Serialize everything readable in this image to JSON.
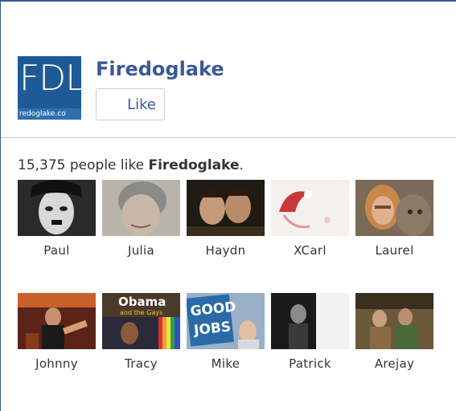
{
  "page": {
    "name": "Firedoglake",
    "logo_text": "FDL",
    "logo_url_text": "redoglake.co",
    "like_label": "Like"
  },
  "fans": {
    "count": "15,375",
    "text_middle": " people like ",
    "page_name": "Firedoglake",
    "period": ".",
    "people": [
      {
        "name": "Paul"
      },
      {
        "name": "Julia"
      },
      {
        "name": "Haydn"
      },
      {
        "name": "XCarl"
      },
      {
        "name": "Laurel"
      },
      {
        "name": "Johnny"
      },
      {
        "name": "Tracy"
      },
      {
        "name": "Mike"
      },
      {
        "name": "Patrick"
      },
      {
        "name": "Arejay"
      }
    ]
  },
  "colors": {
    "brand": "#3b5998",
    "logo_bg": "#1e5a96"
  }
}
